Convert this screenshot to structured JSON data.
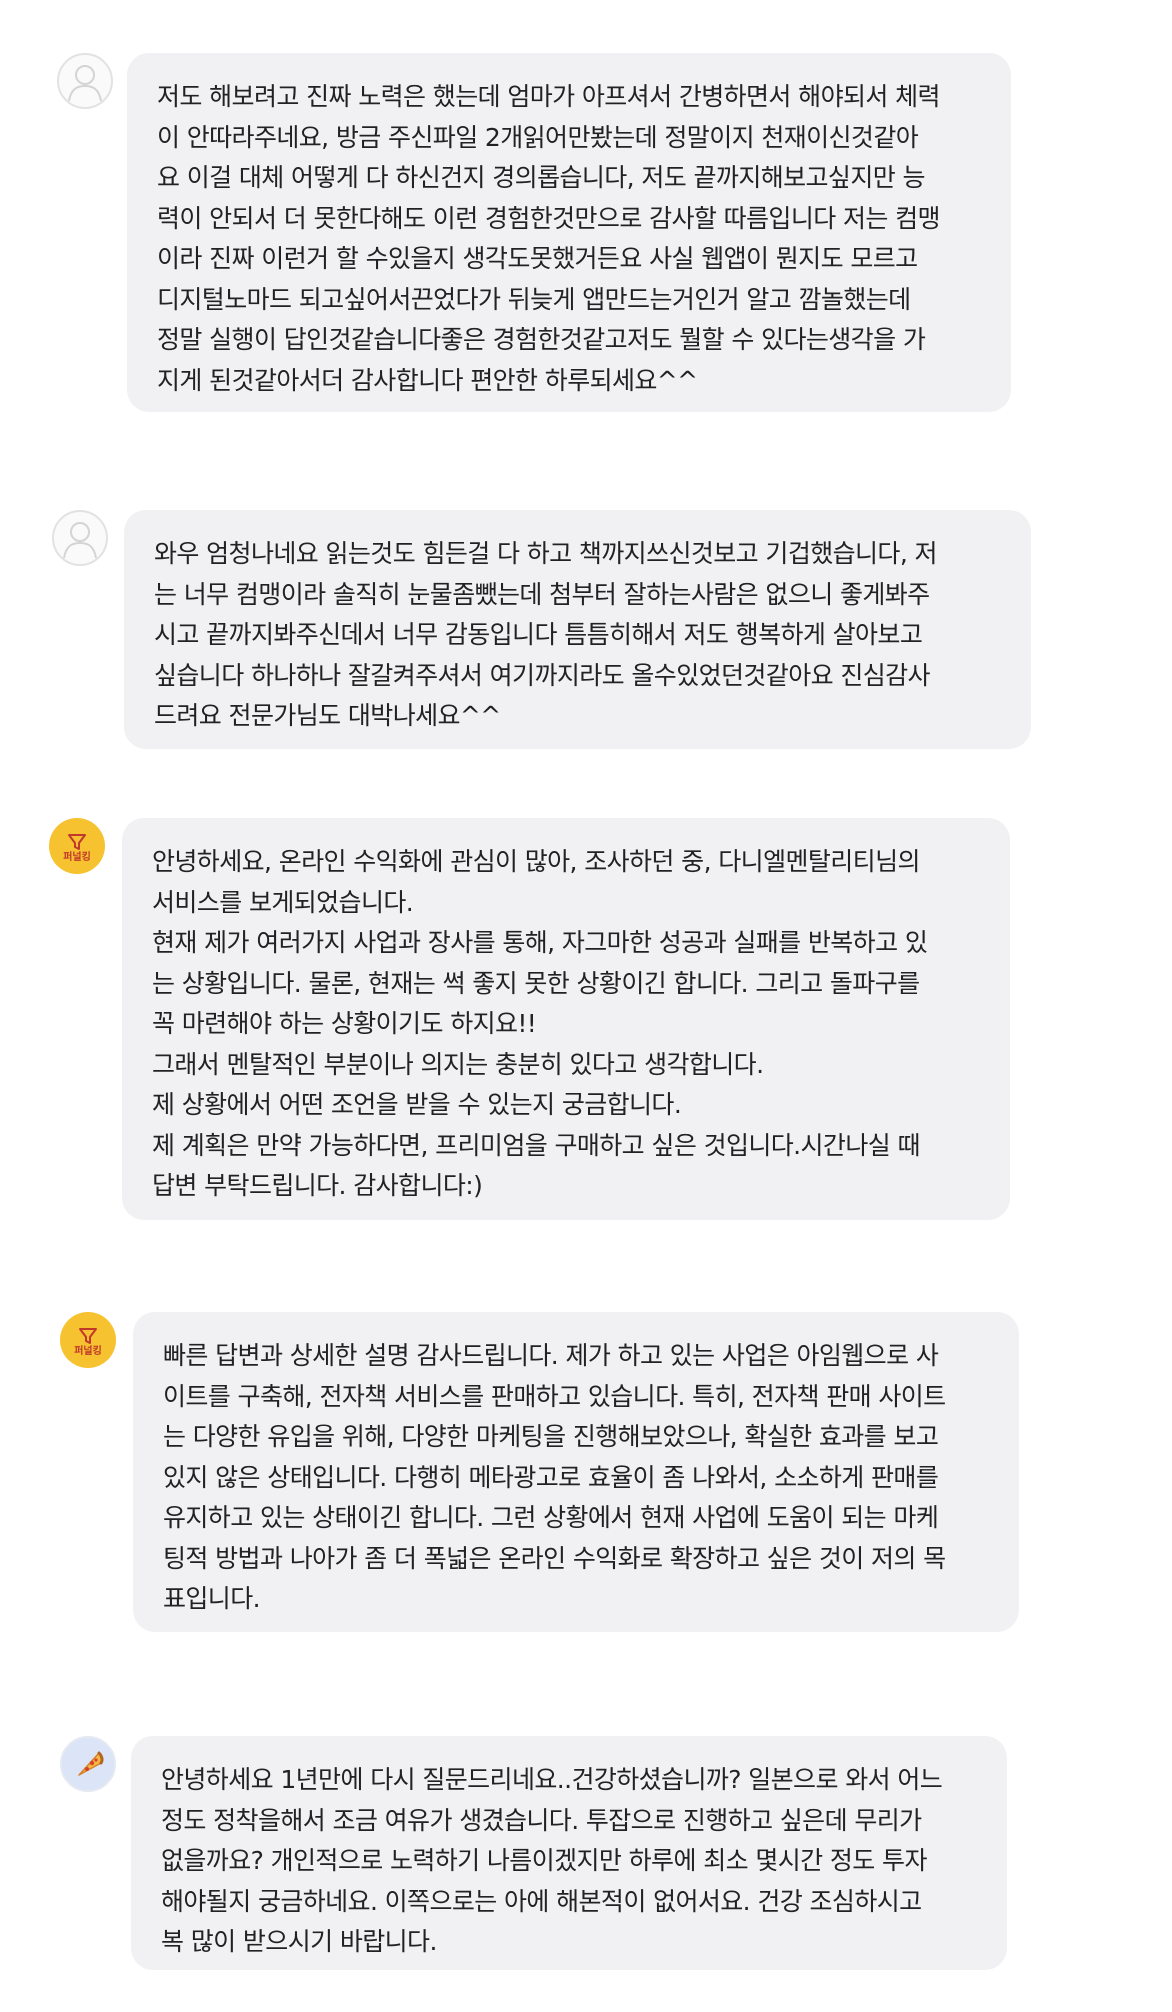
{
  "comments": [
    {
      "avatar": "default-user-avatar",
      "lines": [
        "저도 해보려고 진짜 노력은 했는데 엄마가 아프셔서 간병하면서 해야되서 체력",
        "이 안따라주네요, 방금 주신파일 2개읽어만봤는데 정말이지 천재이신것같아",
        "요 이걸 대체 어떻게 다 하신건지 경의롭습니다, 저도 끝까지해보고싶지만 능",
        "력이 안되서 더 못한다해도 이런 경험한것만으로 감사할 따름입니다 저는 컴맹",
        "이라 진짜 이런거 할 수있을지 생각도못했거든요 사실 웹앱이 뭔지도 모르고",
        "디지털노마드 되고싶어서끈었다가 뒤늦게 앱만드는거인거 알고 깜놀했는데",
        "정말 실행이 답인것같습니다좋은 경험한것같고저도 뭘할 수 있다는생각을 가",
        "지게 된것같아서더 감사합니다 편안한 하루되세요^^"
      ]
    },
    {
      "avatar": "default-user-avatar",
      "lines": [
        "와우 엄청나네요 읽는것도 힘든걸 다 하고 책까지쓰신것보고 기겁했습니다, 저",
        "는 너무 컴맹이라 솔직히 눈물좀뺐는데 첨부터 잘하는사람은 없으니 좋게봐주",
        "시고 끝까지봐주신데서 너무 감동입니다 틈틈히해서 저도 행복하게 살아보고",
        "싶습니다 하나하나 잘갈켜주셔서 여기까지라도 올수있었던것같아요 진심감사",
        "드려요 전문가님도 대박나세요^^"
      ]
    },
    {
      "avatar": "funnel-brand-avatar",
      "avatar_text": "퍼널킹",
      "lines": [
        "안녕하세요, 온라인 수익화에 관심이 많아, 조사하던 중, 다니엘멘탈리티님의",
        "서비스를 보게되었습니다.",
        "현재 제가 여러가지 사업과 장사를 통해, 자그마한 성공과 실패를 반복하고 있",
        "는 상황입니다. 물론, 현재는 썩 좋지 못한 상황이긴 합니다. 그리고 돌파구를",
        "꼭 마련해야 하는 상황이기도 하지요!!",
        "그래서 멘탈적인 부분이나 의지는 충분히 있다고 생각합니다.",
        "제 상황에서 어떤 조언을 받을 수 있는지 궁금합니다.",
        "제 계획은 만약 가능하다면, 프리미엄을 구매하고 싶은 것입니다.시간나실 때",
        "답변 부탁드립니다. 감사합니다:)"
      ]
    },
    {
      "avatar": "funnel-brand-avatar",
      "avatar_text": "퍼널킹",
      "lines": [
        "빠른 답변과 상세한 설명 감사드립니다. 제가 하고 있는 사업은 아임웹으로 사",
        "이트를 구축해, 전자책 서비스를 판매하고 있습니다. 특히, 전자책 판매 사이트",
        "는 다양한 유입을 위해, 다양한 마케팅을 진행해보았으나, 확실한 효과를 보고",
        "있지 않은 상태입니다. 다행히 메타광고로 효율이 좀 나와서, 소소하게 판매를",
        "유지하고 있는 상태이긴 합니다. 그런 상황에서 현재 사업에 도움이 되는 마케",
        "팅적 방법과 나아가 좀 더 폭넓은 온라인 수익화로 확장하고 싶은 것이 저의 목",
        "표입니다."
      ]
    },
    {
      "avatar": "pizza-avatar",
      "lines": [
        "안녕하세요 1년만에 다시 질문드리네요..건강하셨습니까? 일본으로 와서 어느",
        "정도 정착을해서 조금 여유가 생겼습니다. 투잡으로 진행하고 싶은데 무리가",
        "없을까요? 개인적으로 노력하기 나름이겠지만 하루에 최소 몇시간 정도 투자",
        "해야될지 궁금하네요. 이쪽으로는 아에 해본적이 없어서요. 건강 조심하시고",
        "복 많이 받으시기 바랍니다."
      ]
    }
  ]
}
